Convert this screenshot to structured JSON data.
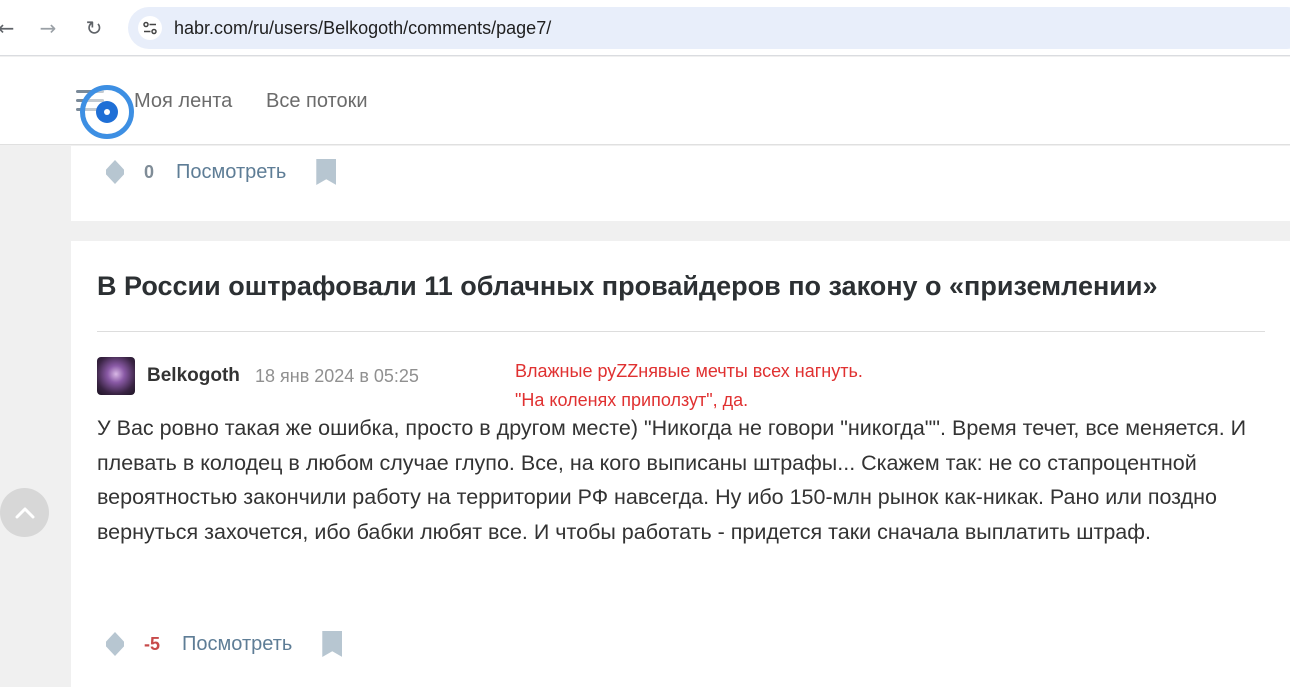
{
  "browser": {
    "url": "habr.com/ru/users/Belkogoth/comments/page7/",
    "back_glyph": "←",
    "forward_glyph": "→",
    "reload_glyph": "↻"
  },
  "header": {
    "links": [
      "Моя лента",
      "Все потоки"
    ]
  },
  "previous_comment": {
    "score": "0",
    "view_label": "Посмотреть"
  },
  "post": {
    "title": "В России оштрафовали 11 облачных провайдеров по закону о «приземлении»",
    "author": "Belkogoth",
    "timestamp": "18 янв 2024 в 05:25",
    "note_lines": [
      "Влажные руZZнявые мечты всех нагнуть.",
      "\"На коленях приползут\", да."
    ],
    "comment_text": "У Вас ровно такая же ошибка, просто в другом месте) \"Никогда не говори \"никогда\"\". Время течет, все меняется. И плевать в колодец в любом случае глупо. Все, на кого выписаны штрафы... Скажем так: не со стапроцентной вероятностью закончили работу на территории РФ навсегда. Ну ибо 150-млн рынок как-никак. Рано или поздно вернуться захочется, ибо бабки любят все. И чтобы работать - придется таки сначала выплатить штраф.",
    "score": "-5",
    "view_label": "Посмотреть"
  },
  "icons": [
    "menu-icon",
    "vote-icon",
    "bookmark-icon",
    "chevron-up-icon",
    "site-info-icon"
  ],
  "colors": {
    "accent": "#5e7d96",
    "negative": "#c74a4a",
    "annotation": "#e03131",
    "omnibox": "#e8eefa"
  }
}
